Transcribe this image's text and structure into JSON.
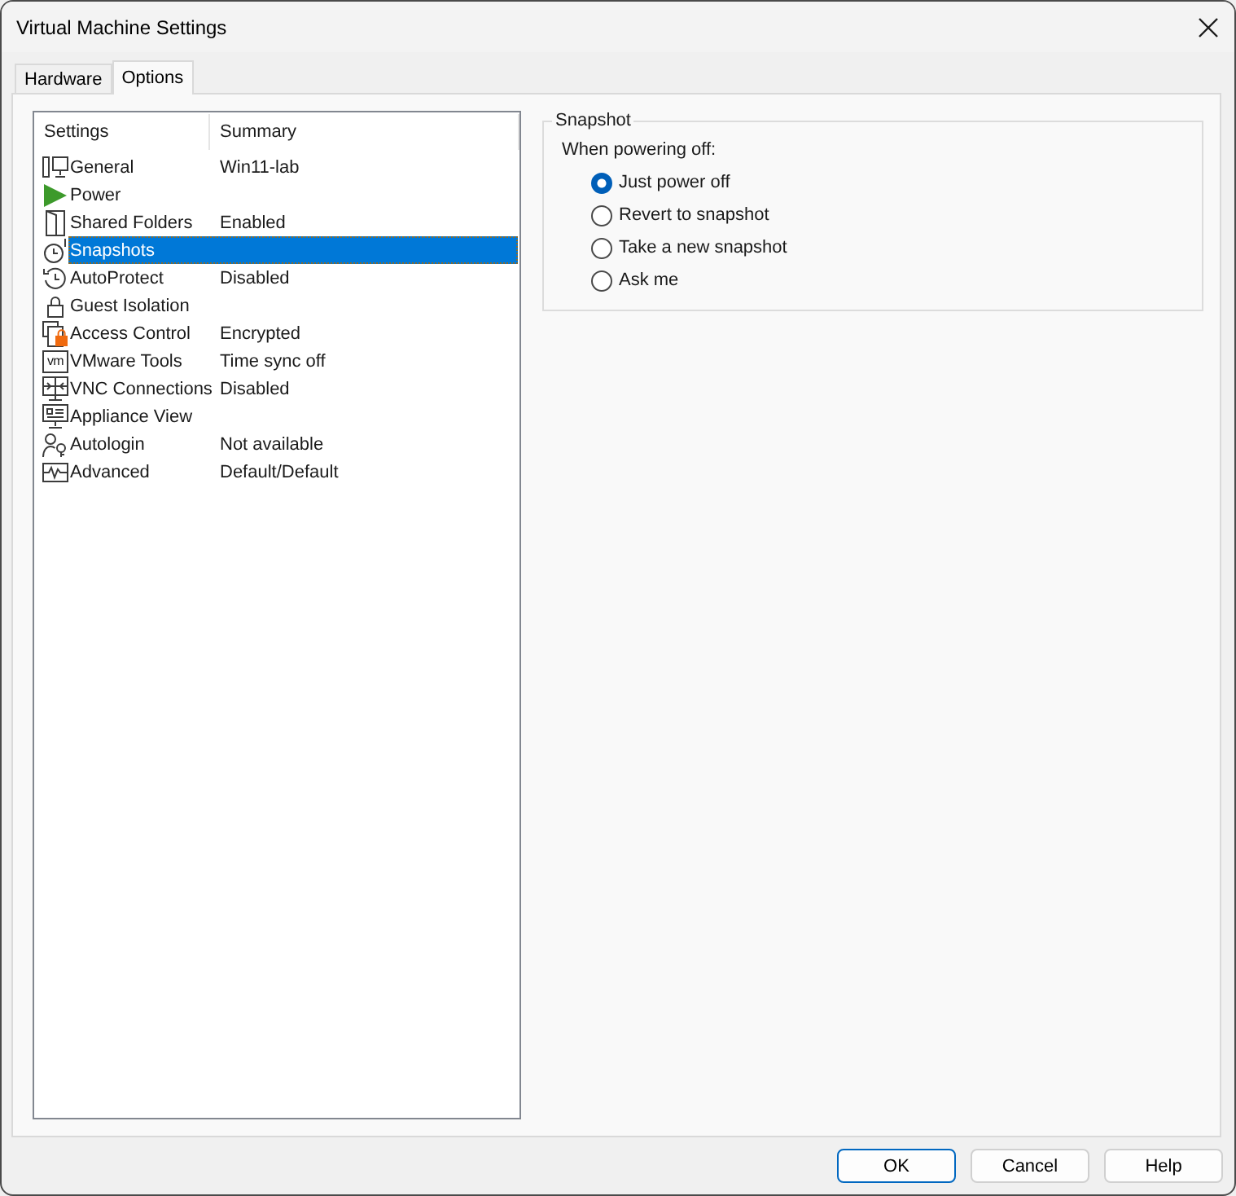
{
  "window": {
    "title": "Virtual Machine Settings"
  },
  "tabs": [
    {
      "label": "Hardware",
      "selected": false
    },
    {
      "label": "Options",
      "selected": true
    }
  ],
  "settings_list": {
    "columns": [
      "Settings",
      "Summary"
    ],
    "rows": [
      {
        "kind": "general",
        "name": "General",
        "summary": "Win11-lab",
        "selected": false
      },
      {
        "kind": "power",
        "name": "Power",
        "selected": false
      },
      {
        "kind": "sharing",
        "name": "Shared Folders",
        "summary": "Enabled",
        "selected": false
      },
      {
        "kind": "snapshot",
        "name": "Snapshots",
        "selected": true
      },
      {
        "kind": "autoprotect",
        "name": "AutoProtect",
        "summary": "Disabled",
        "selected": false
      },
      {
        "kind": "isolation",
        "name": "Guest Isolation",
        "selected": false
      },
      {
        "kind": "access",
        "name": "Access Control",
        "summary": "Encrypted",
        "selected": false
      },
      {
        "kind": "tools",
        "logo": "vm",
        "name": "VMware Tools",
        "summary": "Time sync off",
        "selected": false
      },
      {
        "kind": "vnc",
        "name": "VNC Connections",
        "summary": "Disabled",
        "selected": false
      },
      {
        "kind": "appliance",
        "name": "Appliance View",
        "selected": false
      },
      {
        "kind": "autologin",
        "name": "Autologin",
        "summary": "Not available",
        "selected": false
      },
      {
        "kind": "advanced",
        "name": "Advanced",
        "summary": "Default/Default",
        "selected": false
      }
    ]
  },
  "snapshot_group": {
    "title": "Snapshot",
    "prompt": "When powering off:",
    "options": [
      {
        "label": "Just power off",
        "selected": true
      },
      {
        "label": "Revert to snapshot",
        "selected": false
      },
      {
        "label": "Take a new snapshot",
        "selected": false
      },
      {
        "label": "Ask me",
        "selected": false
      }
    ]
  },
  "buttons": [
    {
      "label": "OK",
      "default": true
    },
    {
      "label": "Cancel",
      "default": false
    },
    {
      "label": "Help",
      "default": false
    }
  ]
}
